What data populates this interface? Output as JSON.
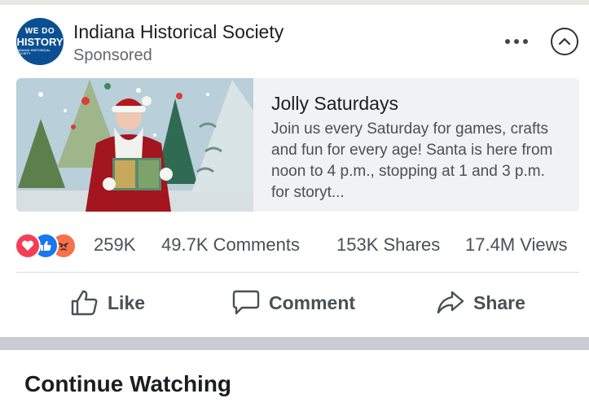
{
  "post": {
    "page_name": "Indiana Historical Society",
    "sponsored_label": "Sponsored",
    "avatar": {
      "line1": "WE DO",
      "line2": "HISTORY",
      "line3": "INDIANA HISTORICAL SOCIETY"
    }
  },
  "link_card": {
    "title": "Jolly Saturdays",
    "description": "Join us every Saturday for games, crafts and fun for every age! Santa is here from noon to 4 p.m., stopping at 1 and 3 p.m. for storyt..."
  },
  "stats": {
    "reactions": "259K",
    "comments": "49.7K Comments",
    "shares": "153K Shares",
    "views": "17.4M Views",
    "reaction_icons": [
      "love-icon",
      "like-icon",
      "angry-icon"
    ]
  },
  "actions": {
    "like": "Like",
    "comment": "Comment",
    "share": "Share"
  },
  "section": {
    "title": "Continue Watching"
  },
  "colors": {
    "like_blue": "#1877f2",
    "love_red": "#f33e58",
    "angry_orange": "#f7714c",
    "avatar_blue": "#0b4f93"
  }
}
